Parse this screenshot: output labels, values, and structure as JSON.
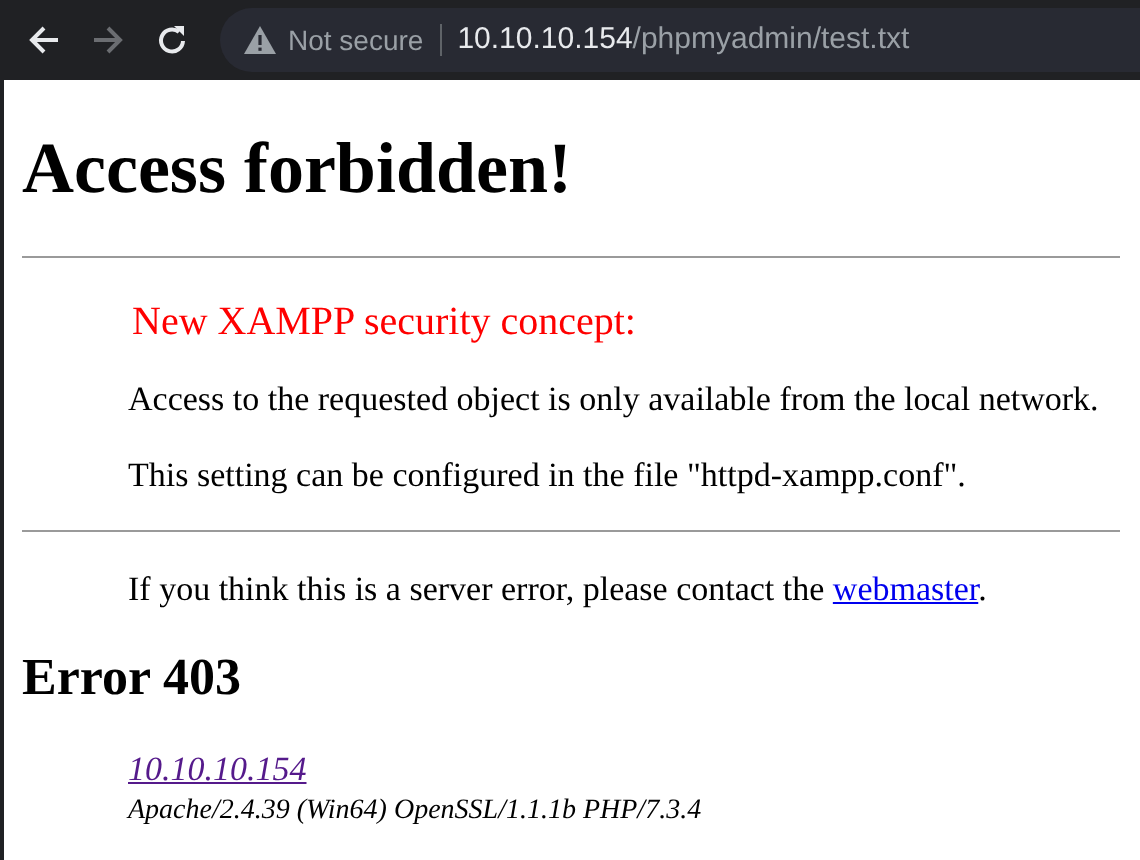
{
  "toolbar": {
    "back": {
      "disabled": false
    },
    "forward": {
      "disabled": true
    },
    "security": "Not secure",
    "url_host": "10.10.10.154",
    "url_path": "/phpmyadmin/test.txt"
  },
  "page": {
    "title": "Access forbidden!",
    "notice": "New XAMPP security concept:",
    "paragraphs": [
      "Access to the requested object is only available from the local network.",
      "This setting can be configured in the file \"httpd-xampp.conf\"."
    ],
    "contact_text": "If you think this is a server error, please contact the ",
    "contact_link": "webmaster",
    "contact_end": ".",
    "error": "Error 403",
    "host_link": "10.10.10.154",
    "server": "Apache/2.4.39 (Win64) OpenSSL/1.1.1b PHP/7.3.4"
  }
}
